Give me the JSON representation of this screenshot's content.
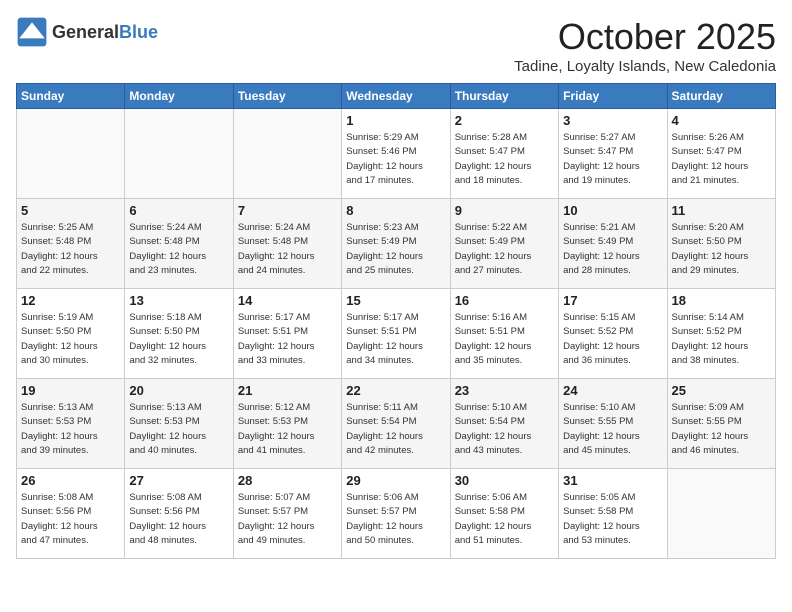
{
  "header": {
    "logo_general": "General",
    "logo_blue": "Blue",
    "title": "October 2025",
    "location": "Tadine, Loyalty Islands, New Caledonia"
  },
  "weekdays": [
    "Sunday",
    "Monday",
    "Tuesday",
    "Wednesday",
    "Thursday",
    "Friday",
    "Saturday"
  ],
  "weeks": [
    [
      {
        "day": "",
        "info": ""
      },
      {
        "day": "",
        "info": ""
      },
      {
        "day": "",
        "info": ""
      },
      {
        "day": "1",
        "info": "Sunrise: 5:29 AM\nSunset: 5:46 PM\nDaylight: 12 hours\nand 17 minutes."
      },
      {
        "day": "2",
        "info": "Sunrise: 5:28 AM\nSunset: 5:47 PM\nDaylight: 12 hours\nand 18 minutes."
      },
      {
        "day": "3",
        "info": "Sunrise: 5:27 AM\nSunset: 5:47 PM\nDaylight: 12 hours\nand 19 minutes."
      },
      {
        "day": "4",
        "info": "Sunrise: 5:26 AM\nSunset: 5:47 PM\nDaylight: 12 hours\nand 21 minutes."
      }
    ],
    [
      {
        "day": "5",
        "info": "Sunrise: 5:25 AM\nSunset: 5:48 PM\nDaylight: 12 hours\nand 22 minutes."
      },
      {
        "day": "6",
        "info": "Sunrise: 5:24 AM\nSunset: 5:48 PM\nDaylight: 12 hours\nand 23 minutes."
      },
      {
        "day": "7",
        "info": "Sunrise: 5:24 AM\nSunset: 5:48 PM\nDaylight: 12 hours\nand 24 minutes."
      },
      {
        "day": "8",
        "info": "Sunrise: 5:23 AM\nSunset: 5:49 PM\nDaylight: 12 hours\nand 25 minutes."
      },
      {
        "day": "9",
        "info": "Sunrise: 5:22 AM\nSunset: 5:49 PM\nDaylight: 12 hours\nand 27 minutes."
      },
      {
        "day": "10",
        "info": "Sunrise: 5:21 AM\nSunset: 5:49 PM\nDaylight: 12 hours\nand 28 minutes."
      },
      {
        "day": "11",
        "info": "Sunrise: 5:20 AM\nSunset: 5:50 PM\nDaylight: 12 hours\nand 29 minutes."
      }
    ],
    [
      {
        "day": "12",
        "info": "Sunrise: 5:19 AM\nSunset: 5:50 PM\nDaylight: 12 hours\nand 30 minutes."
      },
      {
        "day": "13",
        "info": "Sunrise: 5:18 AM\nSunset: 5:50 PM\nDaylight: 12 hours\nand 32 minutes."
      },
      {
        "day": "14",
        "info": "Sunrise: 5:17 AM\nSunset: 5:51 PM\nDaylight: 12 hours\nand 33 minutes."
      },
      {
        "day": "15",
        "info": "Sunrise: 5:17 AM\nSunset: 5:51 PM\nDaylight: 12 hours\nand 34 minutes."
      },
      {
        "day": "16",
        "info": "Sunrise: 5:16 AM\nSunset: 5:51 PM\nDaylight: 12 hours\nand 35 minutes."
      },
      {
        "day": "17",
        "info": "Sunrise: 5:15 AM\nSunset: 5:52 PM\nDaylight: 12 hours\nand 36 minutes."
      },
      {
        "day": "18",
        "info": "Sunrise: 5:14 AM\nSunset: 5:52 PM\nDaylight: 12 hours\nand 38 minutes."
      }
    ],
    [
      {
        "day": "19",
        "info": "Sunrise: 5:13 AM\nSunset: 5:53 PM\nDaylight: 12 hours\nand 39 minutes."
      },
      {
        "day": "20",
        "info": "Sunrise: 5:13 AM\nSunset: 5:53 PM\nDaylight: 12 hours\nand 40 minutes."
      },
      {
        "day": "21",
        "info": "Sunrise: 5:12 AM\nSunset: 5:53 PM\nDaylight: 12 hours\nand 41 minutes."
      },
      {
        "day": "22",
        "info": "Sunrise: 5:11 AM\nSunset: 5:54 PM\nDaylight: 12 hours\nand 42 minutes."
      },
      {
        "day": "23",
        "info": "Sunrise: 5:10 AM\nSunset: 5:54 PM\nDaylight: 12 hours\nand 43 minutes."
      },
      {
        "day": "24",
        "info": "Sunrise: 5:10 AM\nSunset: 5:55 PM\nDaylight: 12 hours\nand 45 minutes."
      },
      {
        "day": "25",
        "info": "Sunrise: 5:09 AM\nSunset: 5:55 PM\nDaylight: 12 hours\nand 46 minutes."
      }
    ],
    [
      {
        "day": "26",
        "info": "Sunrise: 5:08 AM\nSunset: 5:56 PM\nDaylight: 12 hours\nand 47 minutes."
      },
      {
        "day": "27",
        "info": "Sunrise: 5:08 AM\nSunset: 5:56 PM\nDaylight: 12 hours\nand 48 minutes."
      },
      {
        "day": "28",
        "info": "Sunrise: 5:07 AM\nSunset: 5:57 PM\nDaylight: 12 hours\nand 49 minutes."
      },
      {
        "day": "29",
        "info": "Sunrise: 5:06 AM\nSunset: 5:57 PM\nDaylight: 12 hours\nand 50 minutes."
      },
      {
        "day": "30",
        "info": "Sunrise: 5:06 AM\nSunset: 5:58 PM\nDaylight: 12 hours\nand 51 minutes."
      },
      {
        "day": "31",
        "info": "Sunrise: 5:05 AM\nSunset: 5:58 PM\nDaylight: 12 hours\nand 53 minutes."
      },
      {
        "day": "",
        "info": ""
      }
    ]
  ]
}
